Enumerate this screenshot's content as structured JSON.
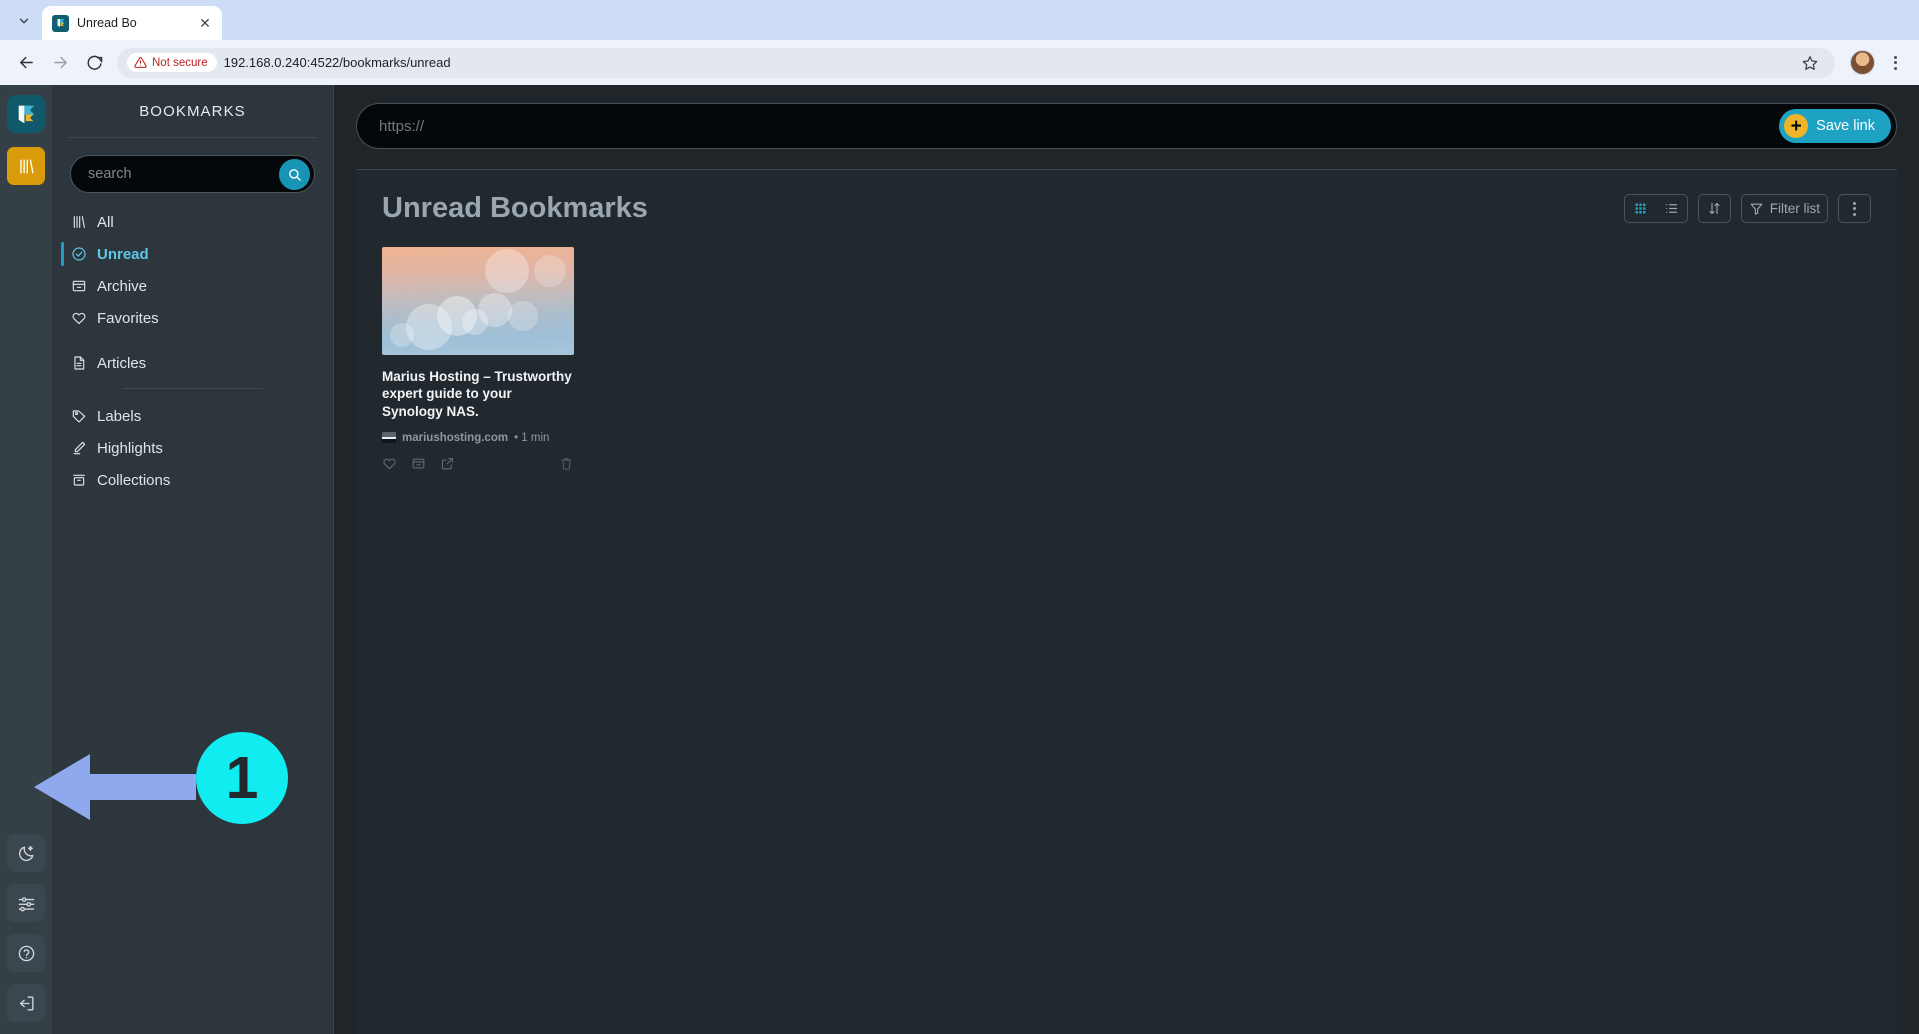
{
  "browser": {
    "tab": {
      "title": "Unread Bo",
      "favicon_name": "readeck-favicon",
      "close_label": "✕"
    },
    "tab_list_icon": "chevron-down-icon",
    "back_icon": "back-arrow-icon",
    "forward_icon": "forward-arrow-icon",
    "reload_icon": "reload-icon",
    "security": {
      "label": "Not secure",
      "icon": "warning-triangle-icon"
    },
    "url": "192.168.0.240:4522/bookmarks/unread",
    "star_icon": "bookmark-star-icon",
    "profile_icon": "profile-avatar",
    "menu_icon": "three-dot-menu-icon"
  },
  "rail": {
    "logo_name": "readeck-logo",
    "books_name": "bookmarks-library-button",
    "bottom_items": [
      {
        "name": "dark-mode-toggle",
        "icon": "moon-icon"
      },
      {
        "name": "settings-button",
        "icon": "sliders-icon"
      },
      {
        "name": "help-button",
        "icon": "question-circle-icon"
      },
      {
        "name": "logout-button",
        "icon": "logout-icon"
      }
    ]
  },
  "sidebar": {
    "title": "BOOKMARKS",
    "search": {
      "placeholder": "search",
      "value": "",
      "button_icon": "search-icon"
    },
    "items": [
      {
        "label": "All",
        "icon": "books-icon",
        "active": false
      },
      {
        "label": "Unread",
        "icon": "check-circle-icon",
        "active": true
      },
      {
        "label": "Archive",
        "icon": "archive-box-icon",
        "active": false
      },
      {
        "label": "Favorites",
        "icon": "heart-icon",
        "active": false
      },
      {
        "label": "Articles",
        "icon": "document-icon",
        "active": false
      },
      {
        "label": "Labels",
        "icon": "tag-icon",
        "active": false
      },
      {
        "label": "Highlights",
        "icon": "pen-highlight-icon",
        "active": false
      },
      {
        "label": "Collections",
        "icon": "collection-box-icon",
        "active": false
      }
    ]
  },
  "savebar": {
    "placeholder": "https://",
    "value": "",
    "button_label": "Save link",
    "plus_glyph": "+"
  },
  "main": {
    "page_title": "Unread Bookmarks",
    "toolbar": {
      "grid_view_label": "grid-view",
      "list_view_label": "list-view",
      "sort_label": "sort",
      "filter_label": "Filter list",
      "more_label": "more-options"
    },
    "cards": [
      {
        "title": "Marius Hosting – Trustworthy expert guide to your Synology NAS.",
        "site": "mariushosting.com",
        "read_time": "• 1 min",
        "actions": [
          "favorite-icon",
          "archive-icon",
          "open-external-icon",
          "delete-icon"
        ]
      }
    ]
  },
  "annotation": {
    "number": "1"
  },
  "colors": {
    "accent_cyan": "#1da2c4",
    "accent_amber": "#d99b09",
    "active_blue": "#5fc6e8",
    "annotation_cyan": "#10ecef",
    "arrow_blue": "#8fa9ef",
    "sidebar_bg": "#2c363c",
    "content_bg": "#22292e"
  }
}
